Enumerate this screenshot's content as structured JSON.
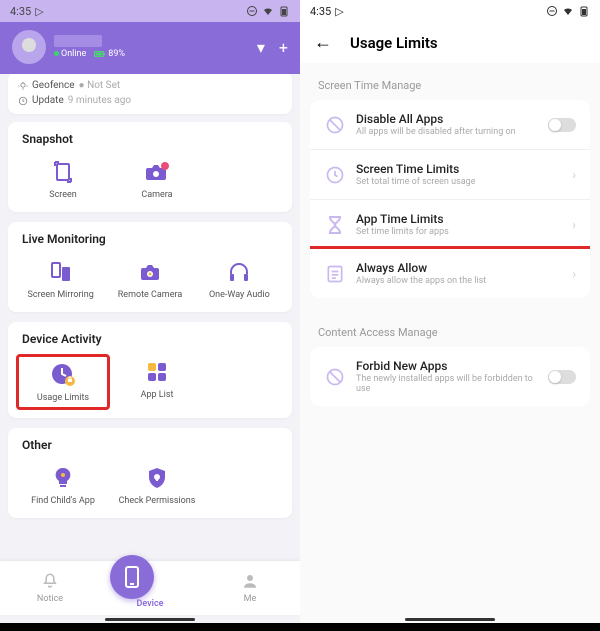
{
  "statusbar": {
    "time": "4:35"
  },
  "left": {
    "header": {
      "online_label": "Online",
      "battery": "89%",
      "caret": "▾",
      "plus": "+"
    },
    "info": {
      "geofence_label": "Geofence",
      "geofence_value": "Not Set",
      "update_label": "Update",
      "update_value": "9 minutes ago"
    },
    "sections": {
      "snapshot": {
        "title": "Snapshot",
        "items": [
          {
            "label": "Screen"
          },
          {
            "label": "Camera"
          }
        ]
      },
      "live": {
        "title": "Live Monitoring",
        "items": [
          {
            "label": "Screen Mirroring"
          },
          {
            "label": "Remote Camera"
          },
          {
            "label": "One-Way Audio"
          }
        ]
      },
      "activity": {
        "title": "Device Activity",
        "items": [
          {
            "label": "Usage Limits"
          },
          {
            "label": "App List"
          }
        ]
      },
      "other": {
        "title": "Other",
        "items": [
          {
            "label": "Find Child's App"
          },
          {
            "label": "Check Permissions"
          }
        ]
      }
    },
    "nav": {
      "notice": "Notice",
      "device": "Device",
      "me": "Me"
    }
  },
  "right": {
    "title": "Usage Limits",
    "section1": {
      "title": "Screen Time Manage",
      "items": [
        {
          "t1": "Disable All Apps",
          "t2": "All apps will be disabled after turning on",
          "toggle": true
        },
        {
          "t1": "Screen Time Limits",
          "t2": "Set total time of screen usage"
        },
        {
          "t1": "App Time Limits",
          "t2": "Set time limits for apps"
        },
        {
          "t1": "Always Allow",
          "t2": "Always allow the apps on the list",
          "highlight": true
        }
      ]
    },
    "section2": {
      "title": "Content Access Manage",
      "items": [
        {
          "t1": "Forbid New Apps",
          "t2": "The newly installed apps will be forbidden to use",
          "toggle": true
        }
      ]
    }
  }
}
